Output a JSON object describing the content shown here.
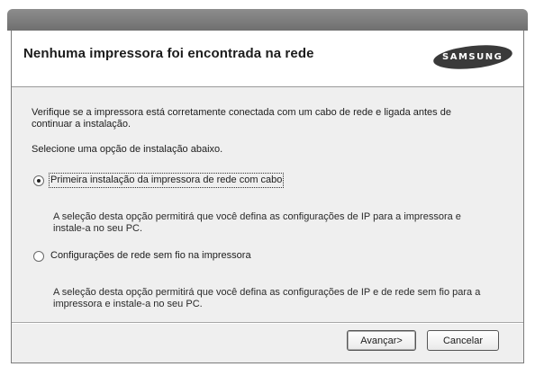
{
  "dialog": {
    "title": "Nenhuma impressora foi encontrada na rede",
    "logo_text": "SAMSUNG"
  },
  "body": {
    "intro_line1": "Verifique se a impressora está corretamente conectada com um cabo de rede e ligada antes de",
    "intro_line2": "continuar a instalação.",
    "prompt": "Selecione uma opção de instalação abaixo."
  },
  "options": [
    {
      "label": "Primeira instalação da impressora de rede com cabo",
      "selected": true,
      "desc_line1": "A seleção desta opção permitirá que você defina as configurações de IP para a impressora e",
      "desc_line2": "instale-a no seu PC."
    },
    {
      "label": "Configurações de rede sem fio na impressora",
      "selected": false,
      "desc_line1": "A seleção desta opção permitirá que você defina as configurações de IP e de rede sem fio para a",
      "desc_line2": "impressora e instale-a no seu PC."
    }
  ],
  "buttons": {
    "next": "Avançar>",
    "cancel": "Cancelar"
  }
}
